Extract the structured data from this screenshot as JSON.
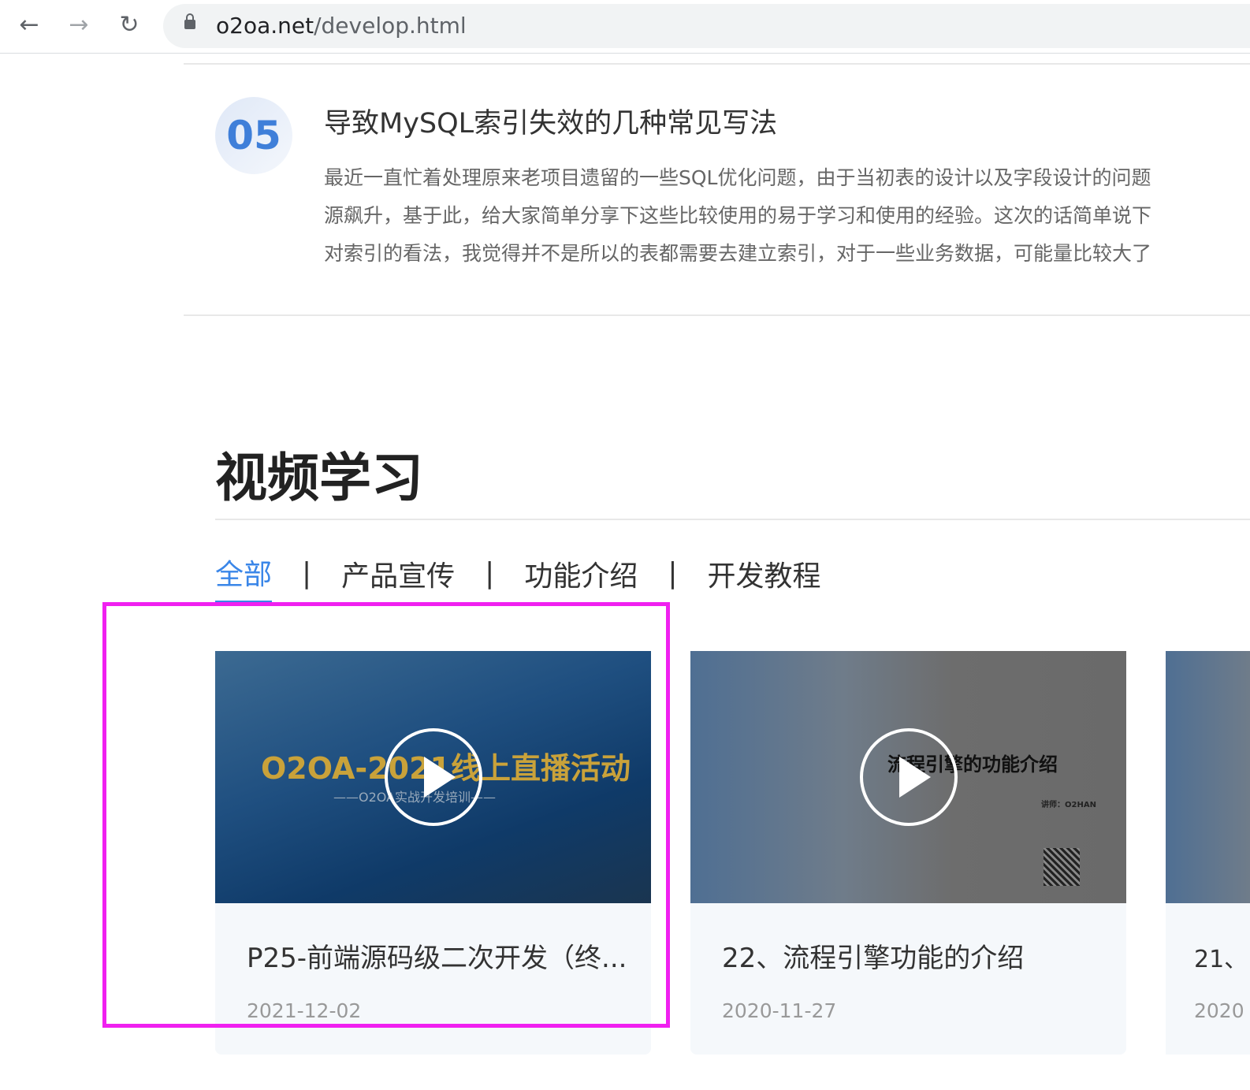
{
  "browser": {
    "url_host": "o2oa.net",
    "url_path": "/develop.html",
    "back": "←",
    "forward": "→",
    "reload": "↻"
  },
  "article": {
    "number": "05",
    "title": "导致MySQL索引失效的几种常见写法",
    "desc": [
      "最近一直忙着处理原来老项目遗留的一些SQL优化问题，由于当初表的设计以及字段设计的问题",
      "源飙升，基于此，给大家简单分享下这些比较使用的易于学习和使用的经验。这次的话简单说下",
      "对索引的看法，我觉得并不是所以的表都需要去建立索引，对于一些业务数据，可能量比较大了"
    ]
  },
  "video_section": {
    "title": "视频学习",
    "tabs": [
      {
        "label": "全部",
        "active": true
      },
      {
        "label": "产品宣传"
      },
      {
        "label": "功能介绍"
      },
      {
        "label": "开发教程"
      }
    ],
    "separator": "|",
    "cards": [
      {
        "title": "P25-前端源码级二次开发（终...",
        "date": "2021-12-02",
        "thumb_text": "O2OA-2021线上直播活动",
        "thumb_sub": "——O2OA实战开发培训——"
      },
      {
        "title": "22、流程引擎功能的介绍",
        "date": "2020-11-27",
        "thumb_text": "流程引擎的功能介绍",
        "thumb_sub": "讲师：O2HAN"
      },
      {
        "title": "21、",
        "date": "2020"
      }
    ]
  },
  "colors": {
    "accent": "#3a86e8",
    "highlight": "#f020f0"
  }
}
